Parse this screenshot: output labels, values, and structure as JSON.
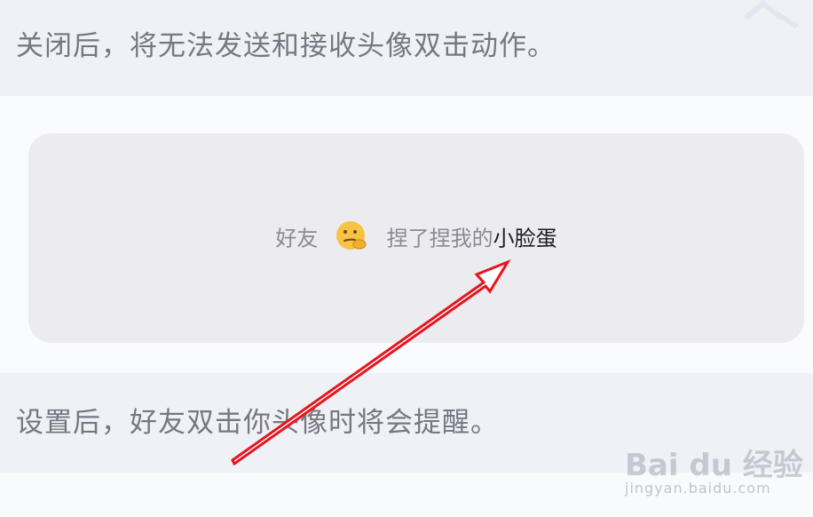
{
  "settings": {
    "close_description": "关闭后，将无法发送和接收头像双击动作。",
    "set_description": "设置后，好友双击你头像时将会提醒。"
  },
  "preview": {
    "prefix": "好友",
    "emoji_icon": "face-with-hand-over-mouth-emoji",
    "action": "捏了捏我的",
    "target": "小脸蛋"
  },
  "watermark": {
    "logo": "Bai du 经验",
    "site": "jingyan.baidu.com"
  },
  "annotation": {
    "arrow_color": "#e8141c"
  }
}
